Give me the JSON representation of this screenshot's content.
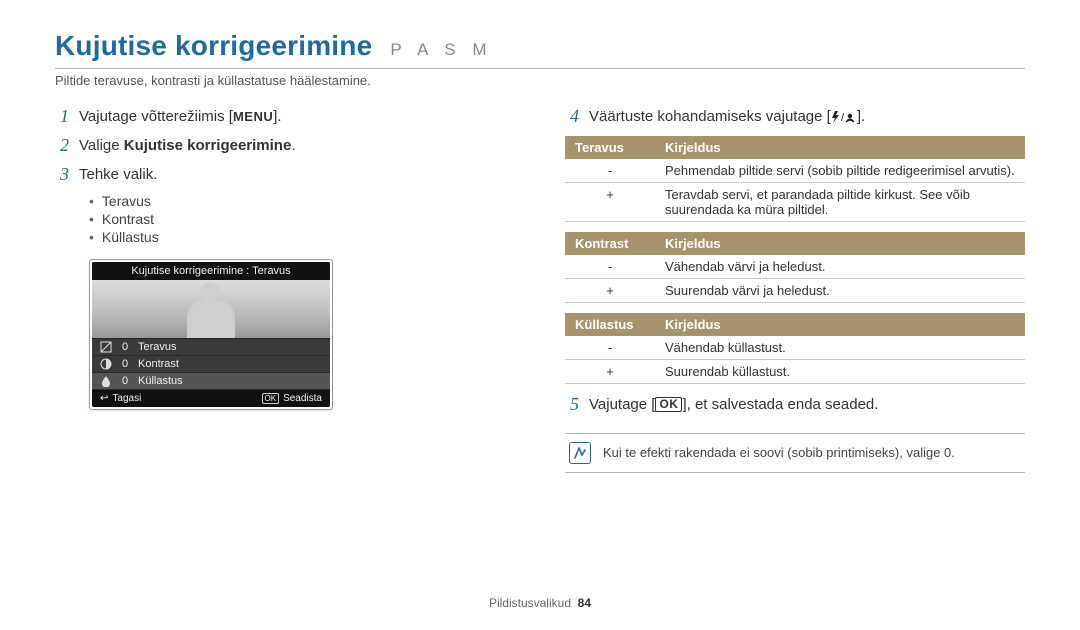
{
  "header": {
    "title": "Kujutise korrigeerimine",
    "modes": "P A S M",
    "subtitle": "Piltide teravuse, kontrasti ja küllastatuse häälestamine."
  },
  "left": {
    "step1": {
      "num": "1",
      "text_before": "Vajutage võtterežiimis [",
      "key": "MENU",
      "text_after": "]."
    },
    "step2": {
      "num": "2",
      "text_before": "Valige ",
      "bold": "Kujutise korrigeerimine",
      "text_after": "."
    },
    "step3": {
      "num": "3",
      "text": "Tehke valik."
    },
    "bullets": [
      "Teravus",
      "Kontrast",
      "Küllastus"
    ],
    "lcd": {
      "title": "Kujutise korrigeerimine : Teravus",
      "rows": [
        {
          "icon": "sharpness",
          "value": "0",
          "label": "Teravus",
          "selected": false
        },
        {
          "icon": "contrast",
          "value": "0",
          "label": "Kontrast",
          "selected": false
        },
        {
          "icon": "saturation",
          "value": "0",
          "label": "Küllastus",
          "selected": true
        }
      ],
      "back_icon": "↩",
      "back": "Tagasi",
      "set_icon": "OK",
      "set": "Seadista"
    }
  },
  "right": {
    "step4": {
      "num": "4",
      "text_before": "Väärtuste kohandamiseks vajutage [",
      "icons": "⚡/🌼",
      "text_after": "]."
    },
    "tables": [
      {
        "head1": "Teravus",
        "head2": "Kirjeldus",
        "rows": [
          {
            "k": "-",
            "v": "Pehmendab piltide servi (sobib piltide redigeerimisel arvutis)."
          },
          {
            "k": "+",
            "v": "Teravdab servi, et parandada piltide kirkust. See võib suurendada ka müra piltidel."
          }
        ]
      },
      {
        "head1": "Kontrast",
        "head2": "Kirjeldus",
        "rows": [
          {
            "k": "-",
            "v": "Vähendab värvi ja heledust."
          },
          {
            "k": "+",
            "v": "Suurendab värvi ja heledust."
          }
        ]
      },
      {
        "head1": "Küllastus",
        "head2": "Kirjeldus",
        "rows": [
          {
            "k": "-",
            "v": "Vähendab küllastust."
          },
          {
            "k": "+",
            "v": "Suurendab küllastust."
          }
        ]
      }
    ],
    "step5": {
      "num": "5",
      "text_before": "Vajutage [",
      "key": "OK",
      "text_after": "], et salvestada enda seaded."
    },
    "note": "Kui te efekti rakendada ei soovi (sobib printimiseks), valige 0."
  },
  "footer": {
    "section": "Pildistusvalikud",
    "page": "84"
  }
}
